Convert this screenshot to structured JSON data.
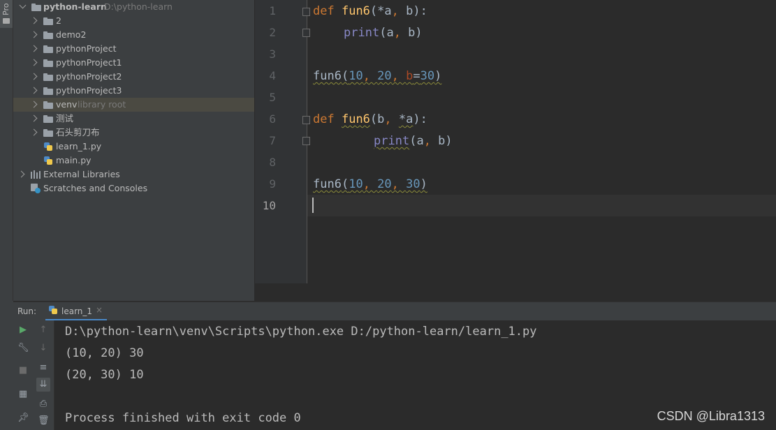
{
  "left_strip": {
    "tab_label": "Pro"
  },
  "project_tree": {
    "root": {
      "name": "python-learn",
      "path": "D:\\python-learn"
    },
    "items": [
      {
        "label": "2"
      },
      {
        "label": "demo2"
      },
      {
        "label": "pythonProject"
      },
      {
        "label": "pythonProject1"
      },
      {
        "label": "pythonProject2"
      },
      {
        "label": "pythonProject3"
      },
      {
        "label": "venv",
        "note": "library root"
      },
      {
        "label": "测试"
      },
      {
        "label": "石头剪刀布"
      }
    ],
    "files": [
      {
        "label": "learn_1.py"
      },
      {
        "label": "main.py"
      }
    ],
    "external_libraries": "External Libraries",
    "scratches": "Scratches and Consoles"
  },
  "editor": {
    "line_numbers": [
      "1",
      "2",
      "3",
      "4",
      "5",
      "6",
      "7",
      "8",
      "9",
      "10"
    ],
    "tokens": {
      "def": "def",
      "fun6": "fun6",
      "print": "print",
      "b": "b",
      "a": "a",
      "star_a": "*a",
      "n10": "10",
      "n20": "20",
      "n30": "30",
      "open": "(",
      "close": ")",
      "colon": "):",
      "comma": ", ",
      "eq": "="
    }
  },
  "run_panel": {
    "label": "Run:",
    "tab": "learn_1",
    "console_lines": [
      "D:\\python-learn\\venv\\Scripts\\python.exe D:/python-learn/learn_1.py",
      "(10, 20) 30",
      "(20, 30) 10",
      "",
      "Process finished with exit code 0"
    ]
  },
  "watermark": "CSDN @Libra1313",
  "colors": {
    "keyword": "#cc7832",
    "function": "#ffc66d",
    "number": "#6897bb",
    "builtin": "#8888c6",
    "editor_bg": "#2b2b2b",
    "panel_bg": "#3c3f41"
  }
}
